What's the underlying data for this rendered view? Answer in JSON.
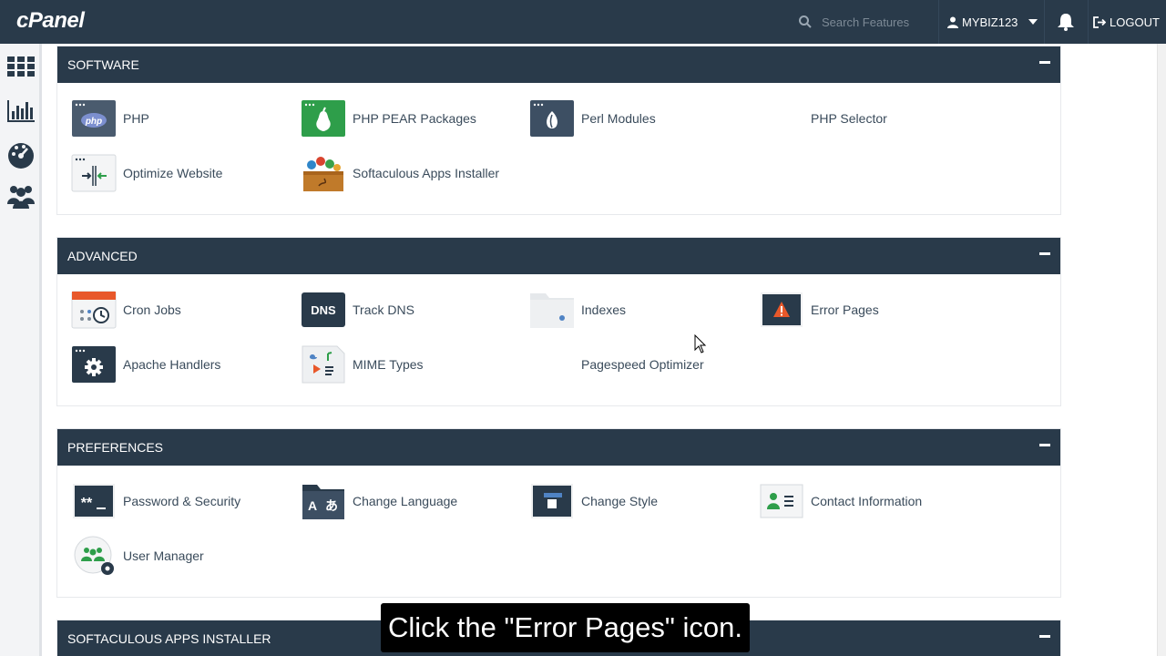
{
  "header": {
    "logo": "cPanel",
    "search_placeholder": "Search Features",
    "username": "MYBIZ123",
    "logout": "LOGOUT"
  },
  "sidebar": {
    "items": [
      "home-grid-icon",
      "stats-icon",
      "dashboard-gauge-icon",
      "users-icon"
    ]
  },
  "sections": {
    "software": {
      "title": "SOFTWARE",
      "items": [
        "PHP",
        "PHP PEAR Packages",
        "Perl Modules",
        "PHP Selector",
        "Optimize Website",
        "Softaculous Apps Installer"
      ]
    },
    "advanced": {
      "title": "ADVANCED",
      "items": [
        "Cron Jobs",
        "Track DNS",
        "Indexes",
        "Error Pages",
        "Apache Handlers",
        "MIME Types",
        "Pagespeed Optimizer"
      ]
    },
    "preferences": {
      "title": "PREFERENCES",
      "items": [
        "Password & Security",
        "Change Language",
        "Change Style",
        "Contact Information",
        "User Manager"
      ]
    },
    "softaculous": {
      "title": "SOFTACULOUS APPS INSTALLER"
    }
  },
  "caption": "Click the \"Error Pages\" icon.",
  "colors": {
    "header_bg": "#293a4a",
    "accent_green": "#2e9e4a",
    "orange": "#e8582a"
  }
}
